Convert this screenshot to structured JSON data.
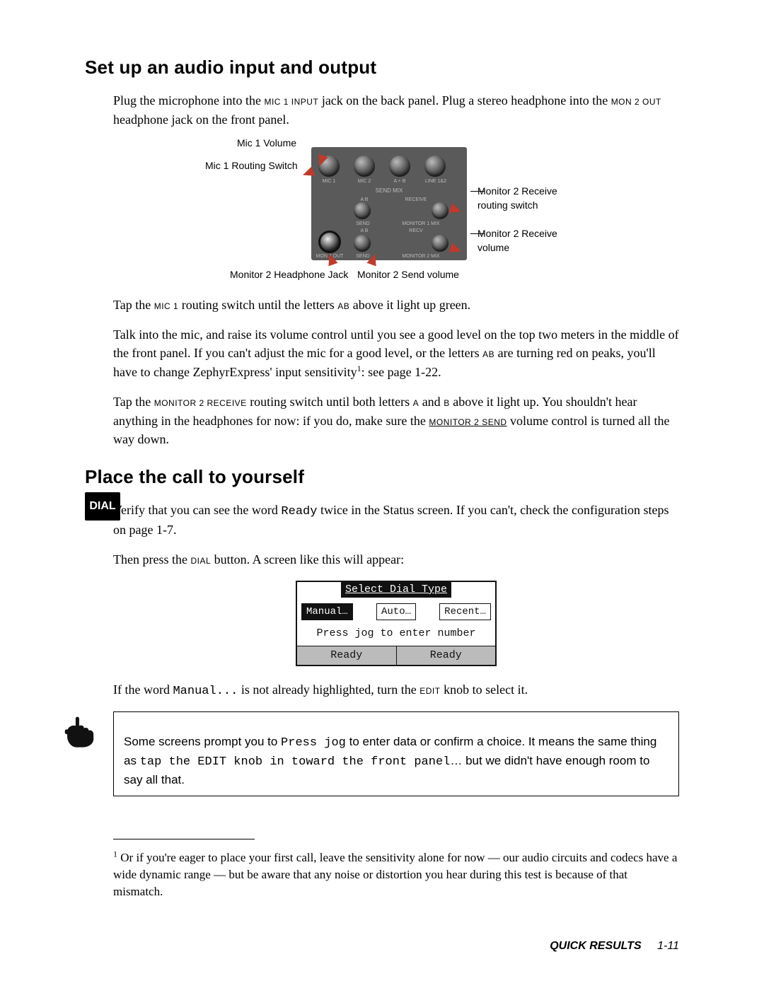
{
  "section1": {
    "heading": "Set up an audio input and output",
    "intro_a": "Plug the microphone into the ",
    "intro_b": " jack on the back panel. Plug a stereo headphone into the ",
    "intro_c": " headphone jack on the front panel.",
    "jack_mic": "MIC 1 INPUT",
    "jack_mon": "MON 2 OUT",
    "labels": {
      "mic1_volume": "Mic 1 Volume",
      "mic1_routing": "Mic 1 Routing Switch",
      "mon2_rx_switch": "Monitor 2 Receive routing switch",
      "mon2_rx_volume": "Monitor 2 Receive volume",
      "mon2_hp_jack": "Monitor 2 Headphone Jack",
      "mon2_send_vol": "Monitor 2 Send volume"
    },
    "panel_text": {
      "mic1": "MIC 1",
      "mic2": "MIC 2",
      "aplusb": "A + B",
      "line12": "LINE 1&2",
      "sendmix": "SEND MIX",
      "ab": "A  B",
      "send": "SEND",
      "receive": "RECEIVE",
      "mon1mix": "MONITOR 1 MIX",
      "mon2out": "MON 2 OUT",
      "recv": "RECV",
      "mon2mix": "MONITOR 2 MIX"
    },
    "p2_a": "Tap the ",
    "p2_b": " routing switch until the letters ",
    "p2_c": " above it light up green.",
    "mic1": "MIC 1",
    "ab": "AB",
    "p3_a": "Talk into the mic, and raise its volume control until you see a good level on the top two meters in the middle of the front panel. If you can't adjust the mic for a good level, or the letters ",
    "p3_b": " are turning red on peaks, you'll have to change ZephyrExpress' input sensitivity",
    "p3_c": ": see page 1-22.",
    "p4_a": "Tap the ",
    "p4_b": " routing switch until both letters ",
    "p4_c": " and ",
    "p4_d": " above it light up. You shouldn't hear anything in the headphones for now: if you do, make sure the ",
    "p4_e": " volume control is turned all the way down.",
    "mon2recv": "MONITOR 2 RECEIVE",
    "letterA": "A",
    "letterB": "B",
    "mon2send": "MONITOR 2 SEND"
  },
  "section2": {
    "heading": "Place the call to yourself",
    "dial_badge": "DIAL",
    "p1_a": "Verify that you can see the word ",
    "p1_b": " twice in the Status screen. If you can't, check the configuration steps on page 1-7.",
    "ready_word": "Ready",
    "p2_a": "Then press the ",
    "p2_b": " button. A screen like this will appear:",
    "dial_word": "DIAL",
    "lcd": {
      "title": "Select Dial Type",
      "manual": "Manual…",
      "auto": "Auto…",
      "recent": "Recent…",
      "hint": "Press jog to enter number",
      "status1": "Ready",
      "status2": "Ready"
    },
    "p3_a": "If the word ",
    "p3_b": " is not already highlighted, turn the ",
    "p3_c": " knob to select it.",
    "manual_word": "Manual...",
    "edit_word": "EDIT",
    "note_a": "Some screens prompt you to ",
    "note_b": " to enter data or confirm a choice. It means the same thing as ",
    "note_c": "… but we didn't have enough room to say all that.",
    "press_jog": "Press jog",
    "tap_edit": "tap the EDIT knob in toward the front panel"
  },
  "footnote": {
    "marker": "1",
    "text": " Or if you're eager to place your first call, leave the sensitivity alone for now — our audio circuits and codecs have a wide dynamic range — but be aware that any noise or distortion you hear during this test is because of that mismatch."
  },
  "footer": {
    "section": "QUICK RESULTS",
    "page": "1-11"
  }
}
